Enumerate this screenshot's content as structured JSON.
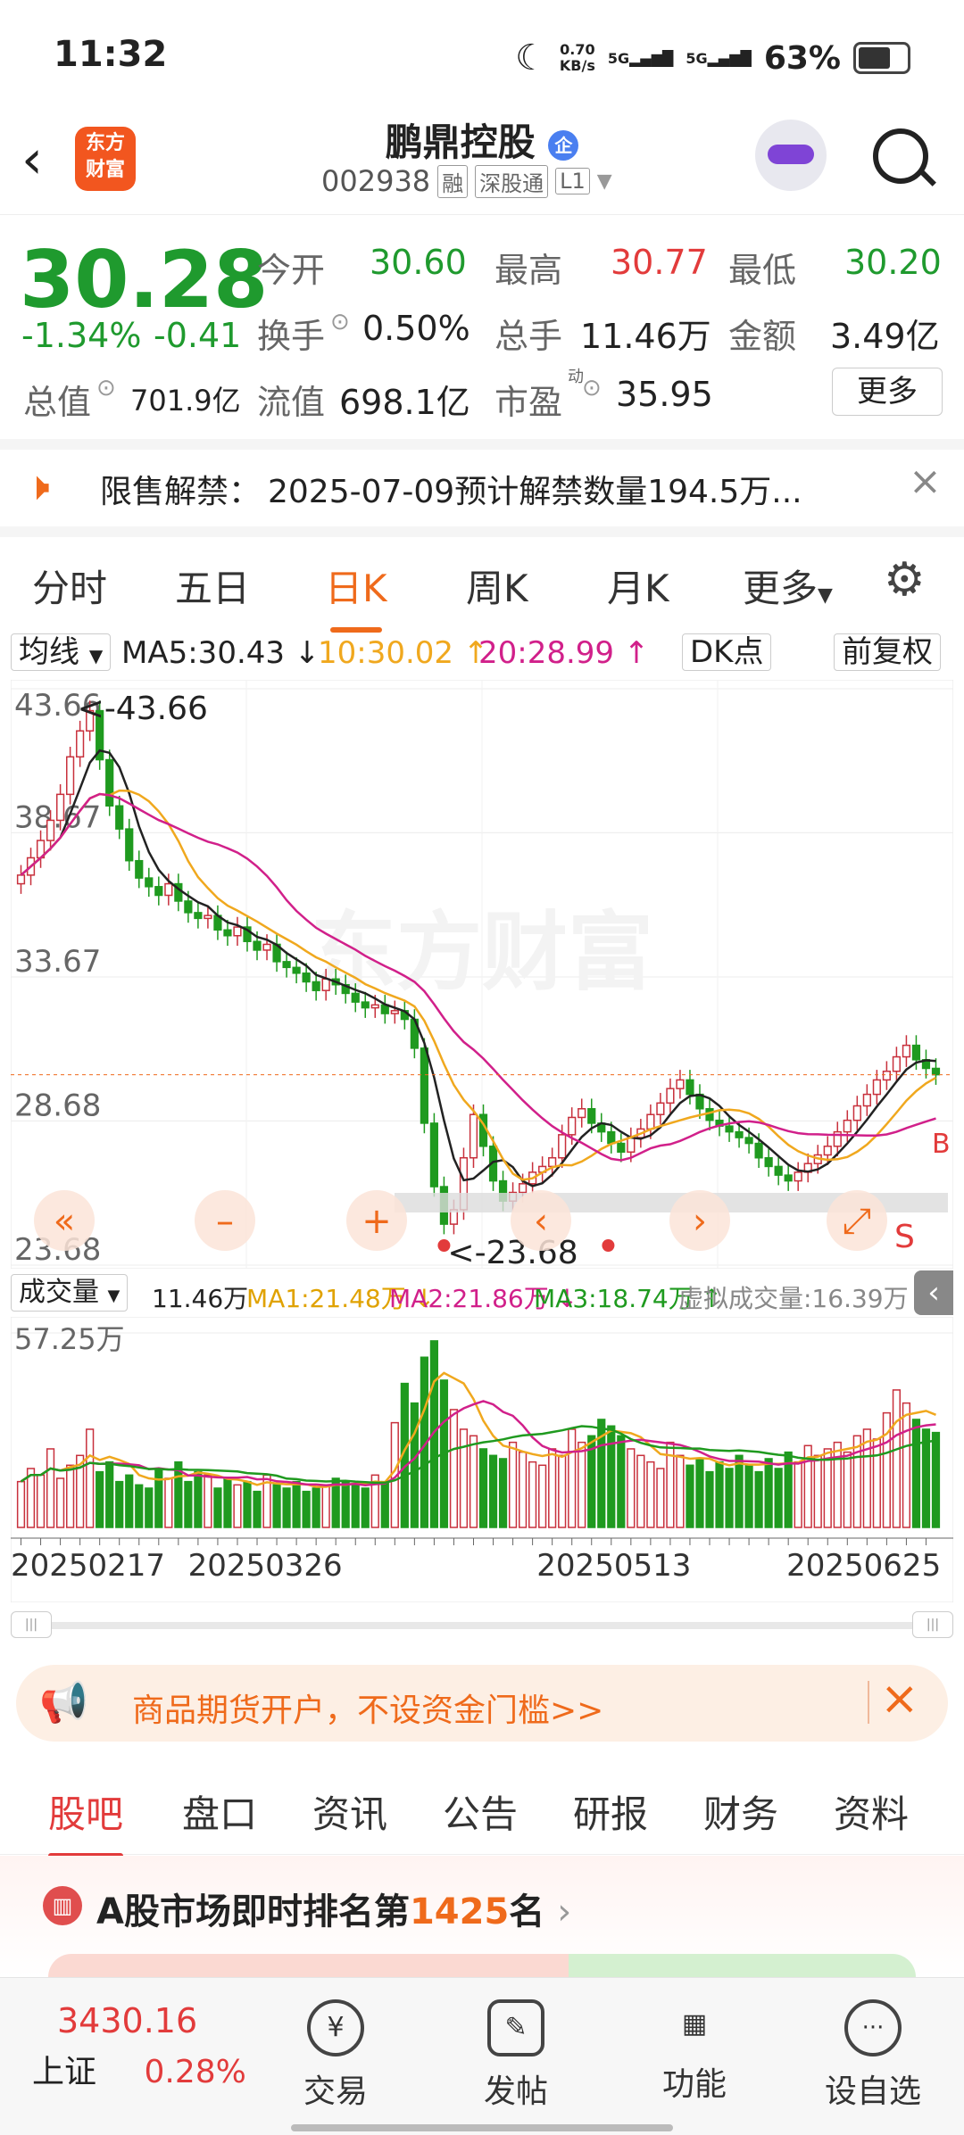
{
  "status_bar": {
    "time": "11:32",
    "net_speed_value": "0.70",
    "net_speed_unit": "KB/s",
    "net1": "5G",
    "net2": "5G",
    "battery": "63%"
  },
  "header": {
    "stock_name": "鹏鼎控股",
    "badge": "企",
    "stock_code": "002938",
    "tags": [
      "融",
      "深股通",
      "L1"
    ],
    "logo_line1": "东方",
    "logo_line2": "财富"
  },
  "quote": {
    "price": "30.28",
    "change_pct": "-1.34%",
    "change_amt": "-0.41",
    "open_label": "今开",
    "open": "30.60",
    "high_label": "最高",
    "high": "30.77",
    "low_label": "最低",
    "low": "30.20",
    "turnover_label": "换手",
    "turnover": "0.50%",
    "volume_label": "总手",
    "volume": "11.46万",
    "amount_label": "金额",
    "amount": "3.49亿",
    "mktcap_label": "总值",
    "mktcap": "701.9亿",
    "float_label": "流值",
    "float_cap": "698.1亿",
    "pe_label": "市盈",
    "pe_sup": "动",
    "pe": "35.95",
    "more": "更多"
  },
  "notice": {
    "label": "限售解禁：",
    "text": "2025-07-09预计解禁数量194.5万..."
  },
  "period_tabs": [
    "分时",
    "五日",
    "日K",
    "周K",
    "月K",
    "更多"
  ],
  "active_period": "日K",
  "ma_bar": {
    "selector": "均线",
    "ma5": "MA5:30.43 ↓",
    "ma10": "10:30.02 ↑",
    "ma20": "20:28.99 ↑",
    "dk": "DK点",
    "adjust": "前复权"
  },
  "colors": {
    "ma5": "#222222",
    "ma10": "#f0a81e",
    "ma20": "#d1208a",
    "up": "#c8303c",
    "down": "#1f9a1f",
    "accent": "#ef6a1b"
  },
  "chart_data": {
    "type": "candlestick",
    "ylim": [
      23.68,
      43.66
    ],
    "y_ticks": [
      "43.66",
      "38.67",
      "33.67",
      "28.68",
      "23.68"
    ],
    "max_label": "<-43.66",
    "min_label": "<-23.68",
    "x_ticks": [
      "20250217",
      "20250326",
      "20250513",
      "20250625"
    ],
    "close": [
      37.2,
      37.8,
      38.4,
      39.1,
      40.0,
      41.3,
      42.2,
      42.9,
      41.2,
      39.6,
      38.8,
      37.7,
      37.1,
      36.8,
      36.5,
      36.9,
      36.3,
      35.9,
      35.7,
      35.8,
      35.3,
      35.1,
      35.4,
      34.9,
      34.6,
      34.8,
      34.2,
      34.0,
      33.8,
      33.5,
      33.2,
      33.6,
      33.4,
      33.1,
      32.8,
      32.6,
      32.7,
      32.4,
      32.5,
      32.2,
      31.2,
      28.6,
      26.4,
      25.1,
      25.6,
      27.4,
      28.9,
      27.8,
      26.6,
      25.9,
      26.2,
      26.5,
      26.9,
      27.1,
      27.4,
      28.2,
      28.8,
      29.1,
      28.6,
      28.3,
      27.9,
      27.6,
      28.1,
      28.4,
      28.9,
      29.3,
      29.8,
      30.1,
      29.6,
      29.1,
      28.7,
      28.5,
      28.3,
      28.1,
      27.9,
      27.4,
      27.1,
      26.8,
      26.6,
      26.9,
      27.2,
      27.5,
      27.8,
      28.3,
      28.7,
      29.2,
      29.6,
      30.1,
      30.4,
      30.9,
      31.3,
      30.8,
      30.5,
      30.28
    ],
    "ma_labels": [
      "MA5",
      "MA10",
      "MA20"
    ],
    "volume": {
      "y_max_label": "57.25万",
      "values": [
        14,
        18,
        16,
        24,
        15,
        19,
        22,
        30,
        17,
        20,
        14,
        16,
        13,
        12,
        18,
        15,
        20,
        14,
        17,
        16,
        12,
        15,
        13,
        14,
        11,
        16,
        13,
        12,
        14,
        11,
        12,
        13,
        15,
        14,
        13,
        12,
        16,
        14,
        32,
        44,
        38,
        52,
        57,
        45,
        36,
        30,
        28,
        24,
        22,
        21,
        26,
        23,
        20,
        19,
        24,
        22,
        30,
        26,
        28,
        33,
        31,
        28,
        24,
        22,
        20,
        18,
        26,
        22,
        19,
        21,
        17,
        20,
        18,
        22,
        19,
        17,
        21,
        18,
        23,
        20,
        25,
        22,
        24,
        26,
        23,
        28,
        30,
        27,
        35,
        42,
        38,
        33,
        30,
        29
      ],
      "current": "11.46万",
      "ma1": "MA1:21.48万 ↓",
      "ma2": "MA2:21.86万 ↓",
      "ma3": "MA3:18.74万 ↑",
      "virtual": "虚拟成交量:16.39万"
    }
  },
  "vol_selector": "成交量",
  "ad": {
    "text": "商品期货开户，不设资金门槛>>"
  },
  "sub_tabs": [
    "股吧",
    "盘口",
    "资讯",
    "公告",
    "研报",
    "财务",
    "资料"
  ],
  "active_sub_tab": "股吧",
  "rank": {
    "prefix": "A股市场即时排名第",
    "number": "1425",
    "suffix": "名"
  },
  "watermark": "东方财富",
  "bottom_nav": {
    "index_value": "3430.16",
    "index_name": "上证",
    "index_change": "0.28%",
    "items": [
      "交易",
      "发帖",
      "功能",
      "设自选"
    ]
  }
}
